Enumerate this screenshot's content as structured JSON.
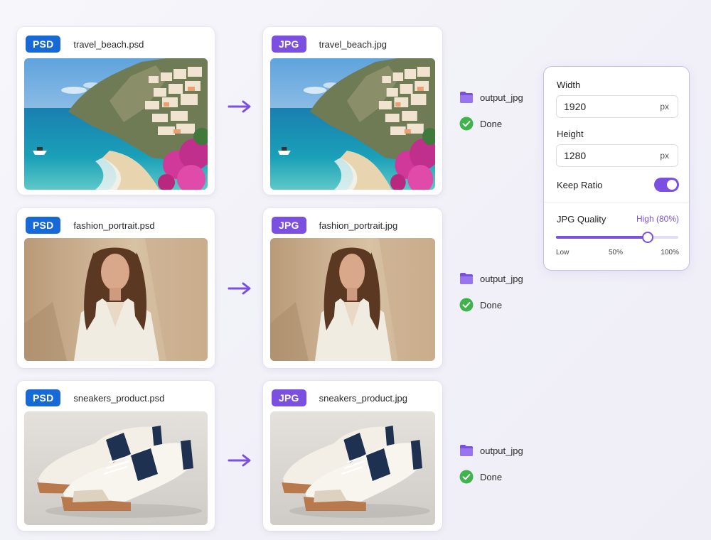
{
  "colors": {
    "accent": "#7b4fe0",
    "psd_badge": "#1769d6",
    "jpg_badge": "#7b4fe0",
    "done": "#3fb44c"
  },
  "conversions": [
    {
      "source": {
        "badge": "PSD",
        "filename": "travel_beach.psd",
        "image": "coastal-cliff-village-photo"
      },
      "output": {
        "badge": "JPG",
        "filename": "travel_beach.jpg",
        "image": "coastal-cliff-village-photo"
      },
      "folder": "output_jpg",
      "status": "Done"
    },
    {
      "source": {
        "badge": "PSD",
        "filename": "fashion_portrait.psd",
        "image": "woman-portrait-photo"
      },
      "output": {
        "badge": "JPG",
        "filename": "fashion_portrait.jpg",
        "image": "woman-portrait-photo"
      },
      "folder": "output_jpg",
      "status": "Done"
    },
    {
      "source": {
        "badge": "PSD",
        "filename": "sneakers_product.psd",
        "image": "sneakers-product-photo"
      },
      "output": {
        "badge": "JPG",
        "filename": "sneakers_product.jpg",
        "image": "sneakers-product-photo"
      },
      "folder": "output_jpg",
      "status": "Done"
    }
  ],
  "settings": {
    "width_label": "Width",
    "width_value": "1920",
    "width_unit": "px",
    "height_label": "Height",
    "height_value": "1280",
    "height_unit": "px",
    "keep_ratio_label": "Keep Ratio",
    "keep_ratio_on": true,
    "quality_label": "JPG Quality",
    "quality_value_text": "High (80%)",
    "quality_level": 0.75,
    "tick_low": "Low",
    "tick_mid": "50%",
    "tick_high": "100%"
  }
}
